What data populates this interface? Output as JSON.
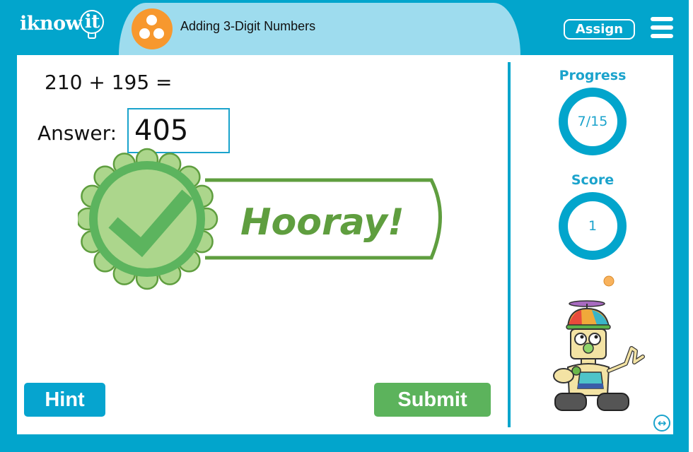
{
  "header": {
    "logo_text": "iknow",
    "logo_bulb_text": "it",
    "lesson_icon": "three-dots-circle-icon",
    "lesson_title": "Adding 3-Digit Numbers",
    "assign_label": "Assign",
    "menu_icon": "hamburger-menu-icon"
  },
  "question": {
    "expression": "210 + 195 =",
    "answer_label": "Answer:",
    "answer_value": "405"
  },
  "feedback": {
    "icon": "checkmark-badge-icon",
    "message": "Hooray!",
    "colors": {
      "dark_green": "#5f9e3f",
      "light_green": "#acd68c",
      "mid_green": "#5cb45e"
    }
  },
  "buttons": {
    "hint_label": "Hint",
    "submit_label": "Submit"
  },
  "sidebar": {
    "progress_label": "Progress",
    "progress_value": "7/15",
    "progress_fraction": 0.4667,
    "score_label": "Score",
    "score_value": "1",
    "mascot": "robot-mascot",
    "expand_icon": "expand-horizontal-icon"
  },
  "colors": {
    "frame": "#02a5cc",
    "header_tab": "#9edcee",
    "lesson_icon": "#f7982e",
    "hint_button": "#06a4cf",
    "submit_button": "#5cb35c"
  }
}
